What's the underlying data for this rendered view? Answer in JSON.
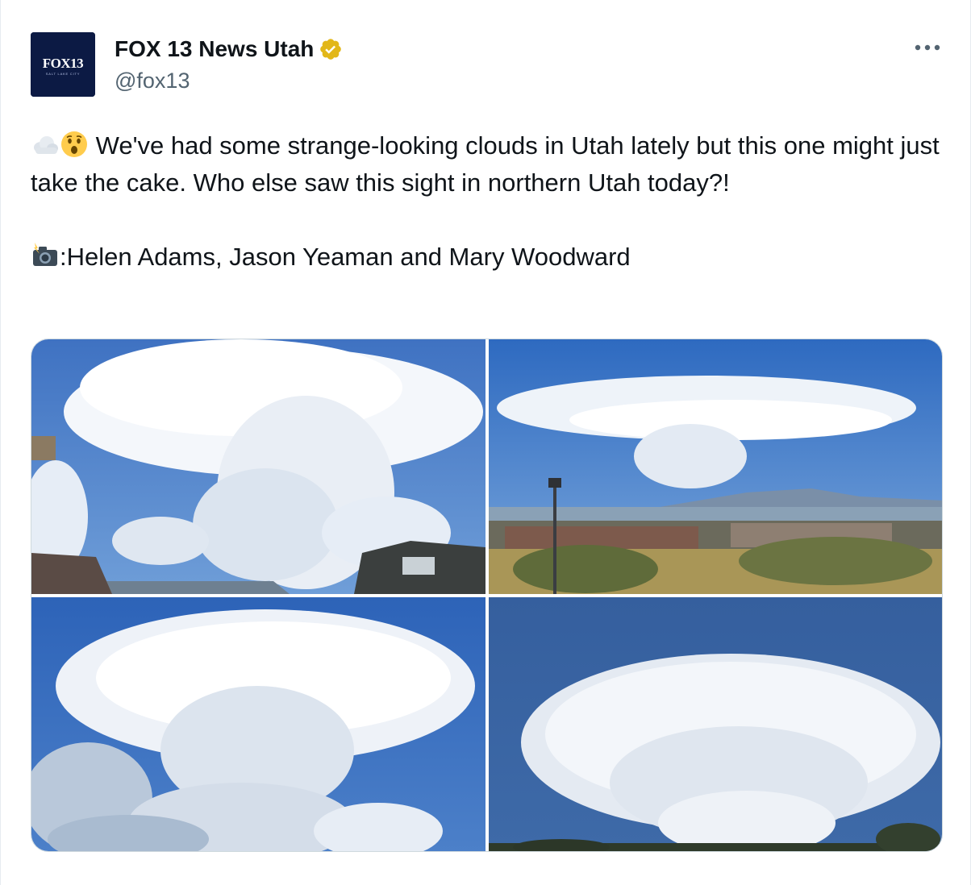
{
  "author": {
    "display_name": "FOX 13 News Utah",
    "handle": "@fox13",
    "avatar": {
      "logo_text": "FOX13",
      "sub_text": "SALT LAKE CITY",
      "icon": "fox13-logo"
    },
    "verified_icon": "verified-badge-icon",
    "verified_color": "#e2b719"
  },
  "more_icon": "more-options-icon",
  "post": {
    "emoji_1": "cloud-emoji",
    "emoji_2": "astonished-face-emoji",
    "text": "We've had some strange-looking clouds in Utah lately but this one might just take the cake. Who else saw this sight in northern Utah today?!",
    "credit_emoji": "camera-flash-emoji",
    "credit_text": ":Helen Adams, Jason Yeaman and Mary Woodward"
  },
  "media": {
    "photos": [
      {
        "subject": "cloud-photo-houses"
      },
      {
        "subject": "cloud-photo-valley"
      },
      {
        "subject": "cloud-photo-cumulus"
      },
      {
        "subject": "cloud-photo-anvil"
      }
    ]
  },
  "colors": {
    "text": "#0f1419",
    "secondary": "#536471",
    "border": "#cfd9de",
    "sky": "#2f67b8"
  }
}
